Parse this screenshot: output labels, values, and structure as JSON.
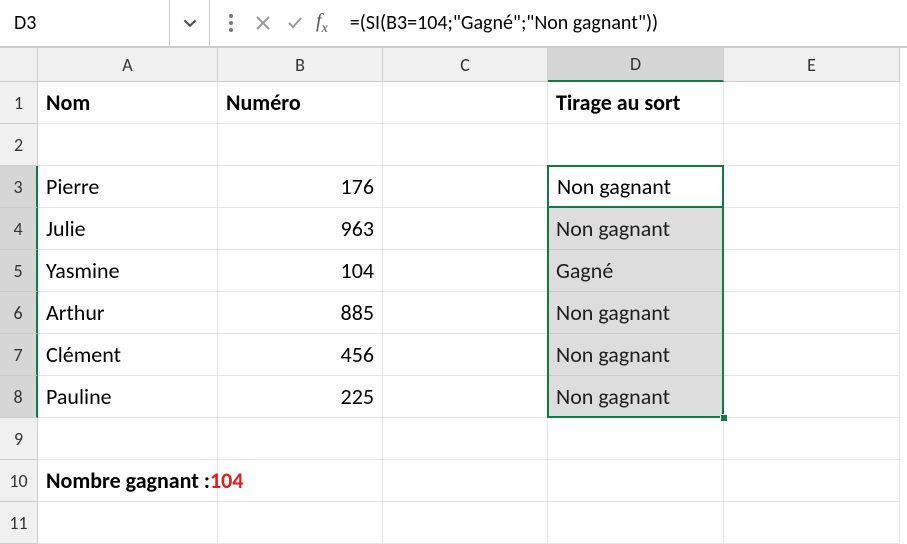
{
  "formulaBar": {
    "cellRef": "D3",
    "formula": "=(SI(B3=104;\"Gagné\";\"Non gagnant\"))"
  },
  "columns": [
    "A",
    "B",
    "C",
    "D",
    "E"
  ],
  "rowNumbers": [
    "1",
    "2",
    "3",
    "4",
    "5",
    "6",
    "7",
    "8",
    "9",
    "10",
    "11"
  ],
  "headers": {
    "A1": "Nom",
    "B1": "Numéro",
    "D1": "Tirage au sort"
  },
  "data": {
    "rows": [
      {
        "nom": "Pierre",
        "numero": "176",
        "resultat": "Non gagnant"
      },
      {
        "nom": "Julie",
        "numero": "963",
        "resultat": "Non gagnant"
      },
      {
        "nom": "Yasmine",
        "numero": "104",
        "resultat": "Gagné"
      },
      {
        "nom": "Arthur",
        "numero": "885",
        "resultat": "Non gagnant"
      },
      {
        "nom": "Clément",
        "numero": "456",
        "resultat": "Non gagnant"
      },
      {
        "nom": "Pauline",
        "numero": "225",
        "resultat": "Non gagnant"
      }
    ]
  },
  "footer": {
    "label": "Nombre gagnant : ",
    "value": "104"
  },
  "selection": {
    "activeCell": "D3",
    "rangeStartRow": 3,
    "rangeEndRow": 8,
    "rangeCol": "D"
  },
  "chart_data": {
    "type": "table",
    "title": "Tirage au sort",
    "columns": [
      "Nom",
      "Numéro",
      "Tirage au sort"
    ],
    "rows": [
      [
        "Pierre",
        176,
        "Non gagnant"
      ],
      [
        "Julie",
        963,
        "Non gagnant"
      ],
      [
        "Yasmine",
        104,
        "Gagné"
      ],
      [
        "Arthur",
        885,
        "Non gagnant"
      ],
      [
        "Clément",
        456,
        "Non gagnant"
      ],
      [
        "Pauline",
        225,
        "Non gagnant"
      ]
    ],
    "winning_number": 104,
    "formula": "=(SI(B3=104;\"Gagné\";\"Non gagnant\"))"
  }
}
